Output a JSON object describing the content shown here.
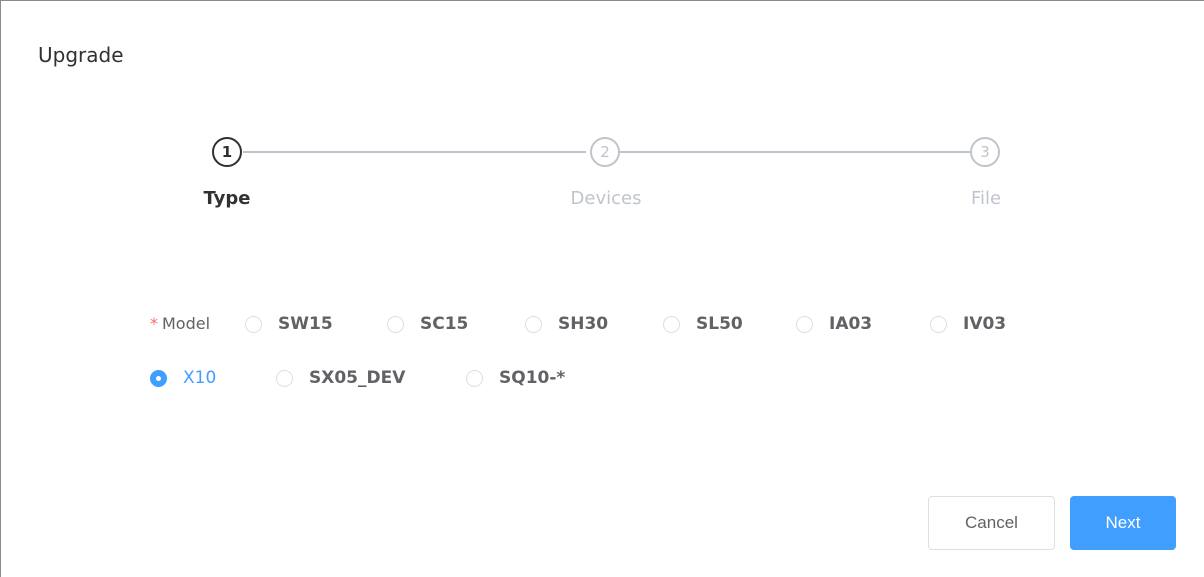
{
  "dialog": {
    "title": "Upgrade"
  },
  "steps": [
    {
      "number": "1",
      "label": "Type",
      "status": "active"
    },
    {
      "number": "2",
      "label": "Devices",
      "status": "wait"
    },
    {
      "number": "3",
      "label": "File",
      "status": "wait"
    }
  ],
  "form": {
    "model_label": "Model",
    "required_mark": "*",
    "options": [
      {
        "label": "SW15",
        "checked": false
      },
      {
        "label": "SC15",
        "checked": false
      },
      {
        "label": "SH30",
        "checked": false
      },
      {
        "label": "SL50",
        "checked": false
      },
      {
        "label": "IA03",
        "checked": false
      },
      {
        "label": "IV03",
        "checked": false
      },
      {
        "label": "X10",
        "checked": true
      },
      {
        "label": "SX05_DEV",
        "checked": false
      },
      {
        "label": "SQ10-*",
        "checked": false
      }
    ]
  },
  "buttons": {
    "cancel_label": "Cancel",
    "next_label": "Next"
  },
  "colors": {
    "primary": "#409eff",
    "required": "#f56c6c",
    "text_active": "#303133",
    "text_inactive": "#c0c4cc"
  }
}
